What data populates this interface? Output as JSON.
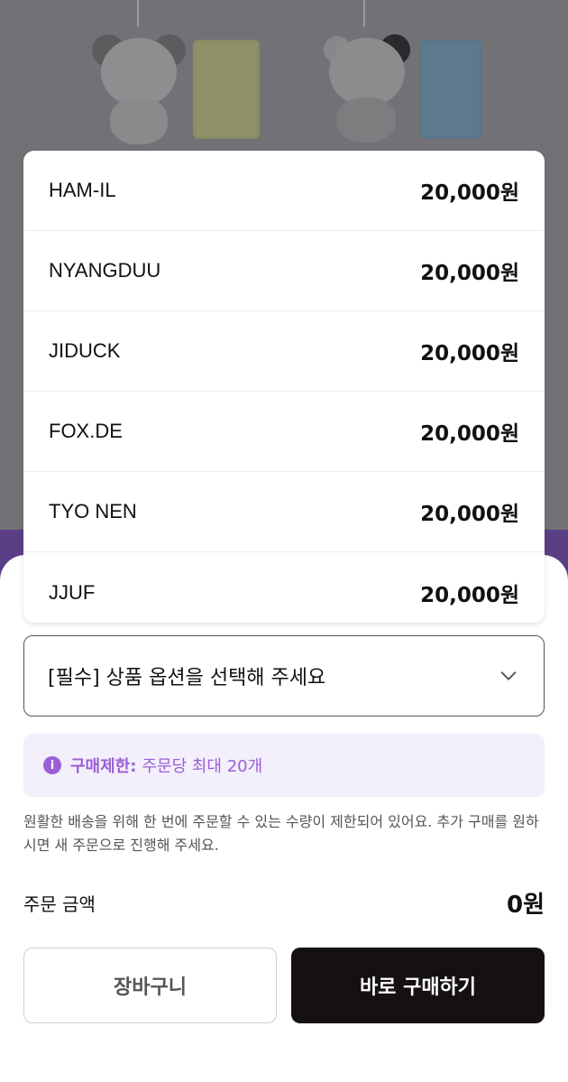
{
  "options": [
    {
      "name": "HAM-IL",
      "price": "20,000원"
    },
    {
      "name": "NYANGDUU",
      "price": "20,000원"
    },
    {
      "name": "JIDUCK",
      "price": "20,000원"
    },
    {
      "name": "FOX.DE",
      "price": "20,000원"
    },
    {
      "name": "TYO NEN",
      "price": "20,000원"
    },
    {
      "name": "JJUF",
      "price": "20,000원"
    }
  ],
  "select": {
    "placeholder": "[필수] 상품 옵션을 선택해 주세요",
    "icon": "chevron-down-icon"
  },
  "notice": {
    "label": "구매제한:",
    "value": "주문당 최대 20개",
    "icon": "info-icon",
    "color": "#9a5fd6"
  },
  "description": "원활한 배송을 위해 한 번에 주문할 수 있는 수량이 제한되어 있어요. 추가 구매를 원하시면 새 주문으로 진행해 주세요.",
  "order_amount": {
    "label": "주문 금액",
    "value": "0원"
  },
  "buttons": {
    "cart": "장바구니",
    "buy": "바로 구매하기"
  },
  "colors": {
    "accent": "#9a5fd6",
    "buy_button": "#151013",
    "backdrop_purple": "#5b3f86"
  }
}
